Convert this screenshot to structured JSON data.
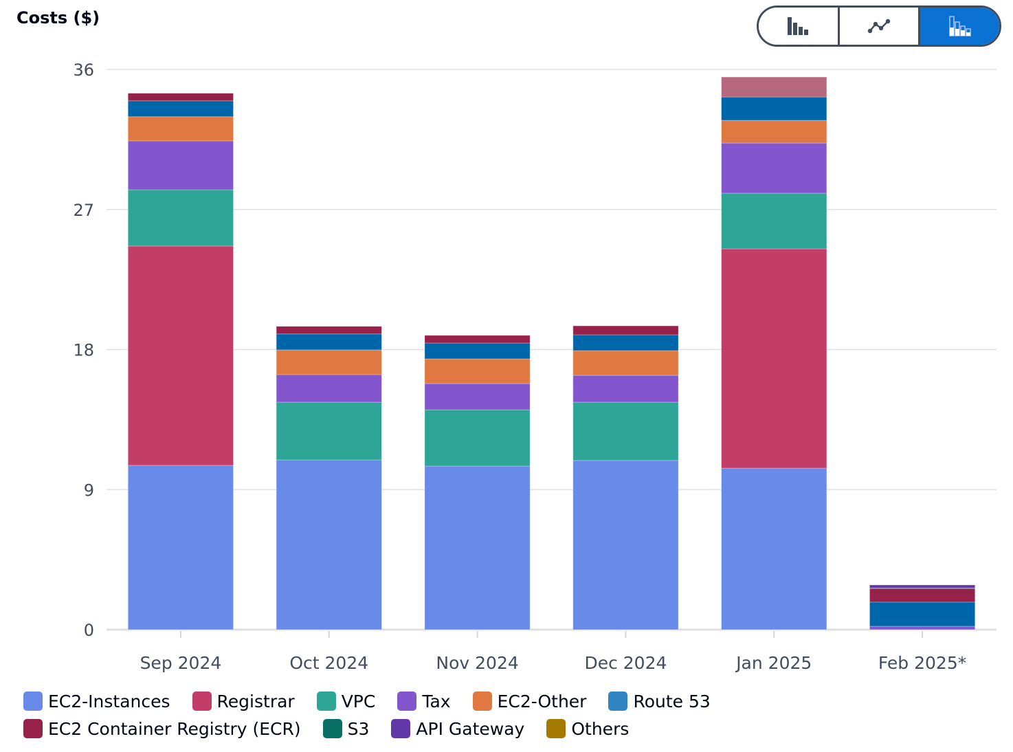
{
  "header": {
    "title": "Costs ($)"
  },
  "view_toggle": {
    "options": [
      {
        "name": "bar-chart",
        "icon": "bar-chart-icon",
        "active": false
      },
      {
        "name": "line-chart",
        "icon": "line-chart-icon",
        "active": false
      },
      {
        "name": "stacked-bar-chart",
        "icon": "stacked-bar-chart-icon",
        "active": true
      }
    ],
    "active_color": "#0972d3"
  },
  "chart_data": {
    "type": "bar",
    "stacked": true,
    "title": "Costs ($)",
    "xlabel": "",
    "ylabel": "Costs ($)",
    "ylim": [
      0,
      36
    ],
    "yticks": [
      0,
      9,
      18,
      27,
      36
    ],
    "grid": true,
    "legend_position": "bottom-left",
    "categories": [
      "Sep 2024",
      "Oct 2024",
      "Nov 2024",
      "Dec 2024",
      "Jan 2025",
      "Feb 2025*"
    ],
    "series": [
      {
        "name": "EC2-Instances",
        "color": "#688ae8",
        "values": [
          10.56,
          10.91,
          10.51,
          10.87,
          10.38,
          0
        ]
      },
      {
        "name": "Registrar",
        "color": "#c33d69",
        "values": [
          14.09,
          0,
          0,
          0,
          14.09,
          0
        ]
      },
      {
        "name": "VPC",
        "color": "#2ea597",
        "values": [
          3.62,
          3.71,
          3.62,
          3.75,
          3.58,
          0
        ]
      },
      {
        "name": "Tax",
        "color": "#8456ce",
        "values": [
          3.14,
          1.77,
          1.68,
          1.72,
          3.22,
          0.22
        ]
      },
      {
        "name": "EC2-Other",
        "color": "#e07941",
        "values": [
          1.55,
          1.59,
          1.59,
          1.59,
          1.46,
          0
        ]
      },
      {
        "name": "Route 53",
        "color": "#3184c2",
        "render_color": "#0066aa",
        "values": [
          1.02,
          1.02,
          1.02,
          1.02,
          1.5,
          1.55
        ]
      },
      {
        "name": "EC2 Container Registry (ECR)",
        "color": "#962249",
        "values": [
          0.49,
          0.49,
          0.49,
          0.57,
          1.28,
          0.88
        ]
      },
      {
        "name": "S3",
        "color": "#096f64",
        "values": [
          0,
          0,
          0,
          0,
          0,
          0.03
        ]
      },
      {
        "name": "API Gateway",
        "color": "#6237a7",
        "values": [
          0,
          0,
          0,
          0,
          0,
          0.19
        ]
      },
      {
        "name": "Others",
        "color": "#a57a00",
        "values": [
          0,
          0,
          0,
          0,
          0,
          0
        ]
      }
    ],
    "highlight_faded": {
      "category": "Jan 2025",
      "series": "EC2 Container Registry (ECR)",
      "color": "#b8687e"
    }
  },
  "legend": {
    "rows": [
      [
        "EC2-Instances",
        "Registrar",
        "VPC",
        "Tax",
        "EC2-Other",
        "Route 53"
      ],
      [
        "EC2 Container Registry (ECR)",
        "S3",
        "API Gateway",
        "Others"
      ]
    ]
  }
}
